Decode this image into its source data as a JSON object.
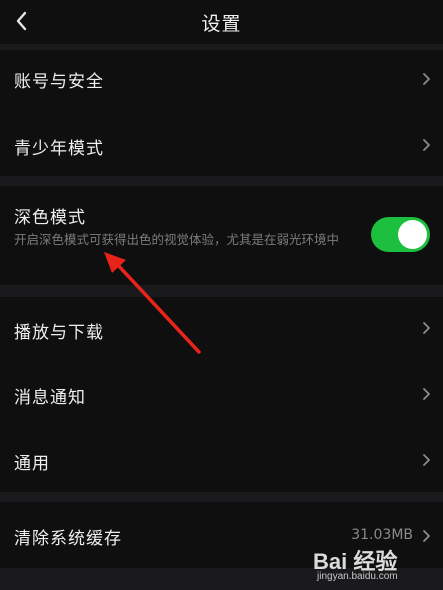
{
  "header": {
    "title": "设置",
    "back_icon": "chevron-left-icon"
  },
  "sections": [
    {
      "items": [
        {
          "label": "账号与安全",
          "icon": "chevron-right-icon"
        },
        {
          "label": "青少年模式",
          "icon": "chevron-right-icon"
        }
      ]
    },
    {
      "dark_mode": {
        "label": "深色模式",
        "description": "开启深色模式可获得出色的视觉体验，尤其是在弱光环境中",
        "toggle_on": true,
        "toggle_color": "#1cbf3e"
      }
    },
    {
      "items": [
        {
          "label": "播放与下载",
          "icon": "chevron-right-icon"
        },
        {
          "label": "消息通知",
          "icon": "chevron-right-icon"
        },
        {
          "label": "通用",
          "icon": "chevron-right-icon"
        }
      ]
    },
    {
      "items": [
        {
          "label": "清除系统缓存",
          "value": "31.03MB",
          "icon": "chevron-right-icon"
        }
      ]
    }
  ],
  "annotation": {
    "type": "arrow",
    "color": "#e8231a"
  },
  "watermark": {
    "brand": "Bai 经验",
    "url": "jingyan.baidu.com"
  },
  "colors": {
    "background": "#0f0f10",
    "separator": "#1a1a1c",
    "text_primary": "#efefef",
    "text_secondary": "#7c7c7c"
  }
}
